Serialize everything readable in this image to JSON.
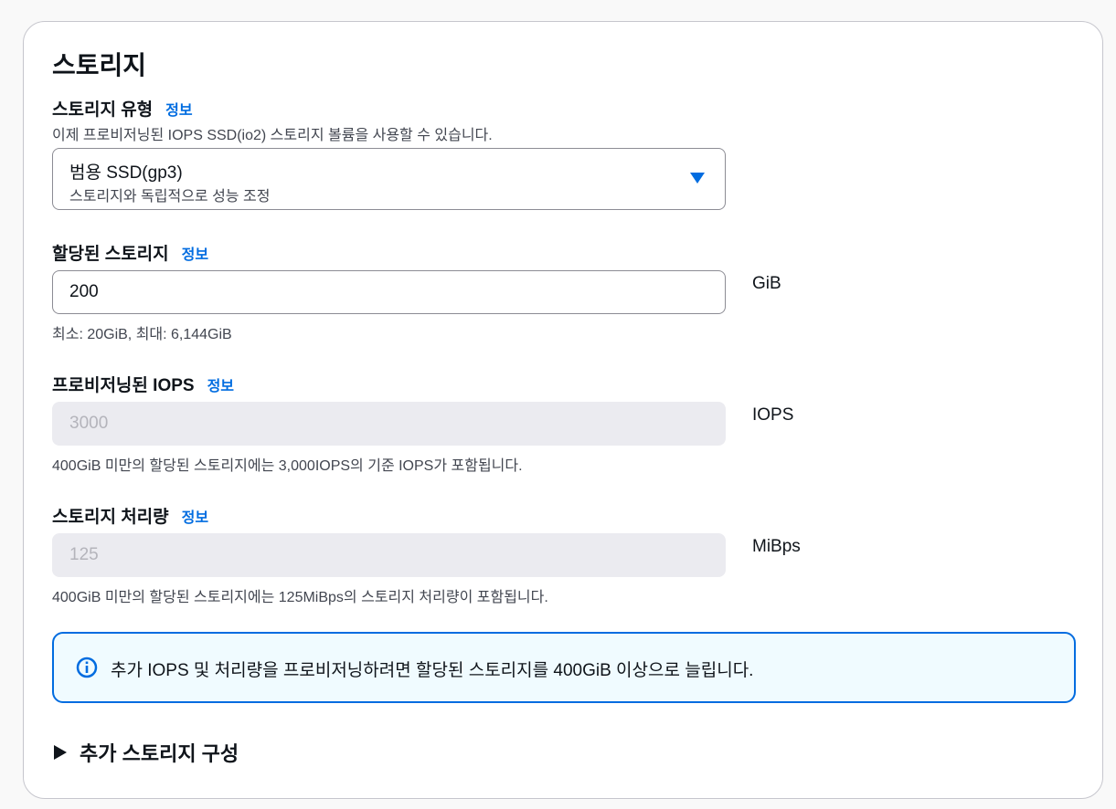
{
  "storage": {
    "title": "스토리지",
    "info_label": "정보",
    "type": {
      "label": "스토리지 유형",
      "description": "이제 프로비저닝된 IOPS SSD(io2) 스토리지 볼륨을 사용할 수 있습니다.",
      "selected": "범용 SSD(gp3)",
      "selected_description": "스토리지와 독립적으로 성능 조정"
    },
    "allocated": {
      "label": "할당된 스토리지",
      "value": "200",
      "unit": "GiB",
      "hint": "최소: 20GiB, 최대: 6,144GiB"
    },
    "iops": {
      "label": "프로비저닝된 IOPS",
      "value": "3000",
      "unit": "IOPS",
      "hint": "400GiB 미만의 할당된 스토리지에는 3,000IOPS의 기준 IOPS가 포함됩니다."
    },
    "throughput": {
      "label": "스토리지 처리량",
      "value": "125",
      "unit": "MiBps",
      "hint": "400GiB 미만의 할당된 스토리지에는 125MiBps의 스토리지 처리량이 포함됩니다."
    },
    "alert": {
      "icon": "info-icon",
      "text": "추가 IOPS 및 처리량을 프로비저닝하려면 할당된 스토리지를 400GiB 이상으로 늘립니다."
    },
    "additional": {
      "label": "추가 스토리지 구성"
    }
  },
  "colors": {
    "accent": "#006ce0",
    "alert_bg": "#f0fbff",
    "disabled_bg": "#ebebf0",
    "border": "#8c8c94"
  }
}
